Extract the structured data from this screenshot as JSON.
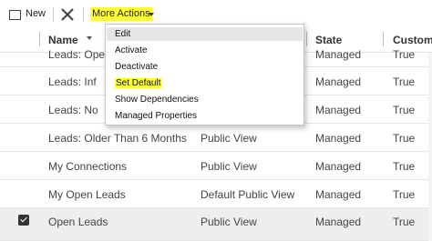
{
  "toolbar": {
    "new_label": "New",
    "more_actions_label": "More Actions",
    "highlight_color": "#ffff33"
  },
  "grid": {
    "columns": [
      "Name",
      "State",
      "Customiz"
    ],
    "rows": [
      {
        "name": "Leads: Ope",
        "type": "",
        "state": "Managed",
        "customizable": "True",
        "selected": false
      },
      {
        "name": "Leads: Inf",
        "type": "",
        "state": "Managed",
        "customizable": "True",
        "selected": false
      },
      {
        "name": "Leads: No",
        "type": "",
        "state": "Managed",
        "customizable": "True",
        "selected": false
      },
      {
        "name": "Leads: Older Than 6 Months",
        "type": "Public View",
        "state": "Managed",
        "customizable": "True",
        "selected": false
      },
      {
        "name": "My Connections",
        "type": "Public View",
        "state": "Managed",
        "customizable": "True",
        "selected": false
      },
      {
        "name": "My Open Leads",
        "type": "Default Public View",
        "state": "Managed",
        "customizable": "True",
        "selected": false
      },
      {
        "name": "Open Leads",
        "type": "Public View",
        "state": "Managed",
        "customizable": "True",
        "selected": true
      }
    ]
  },
  "menu": {
    "items": [
      "Edit",
      "Activate",
      "Deactivate",
      "Set Default",
      "Show Dependencies",
      "Managed Properties"
    ]
  }
}
